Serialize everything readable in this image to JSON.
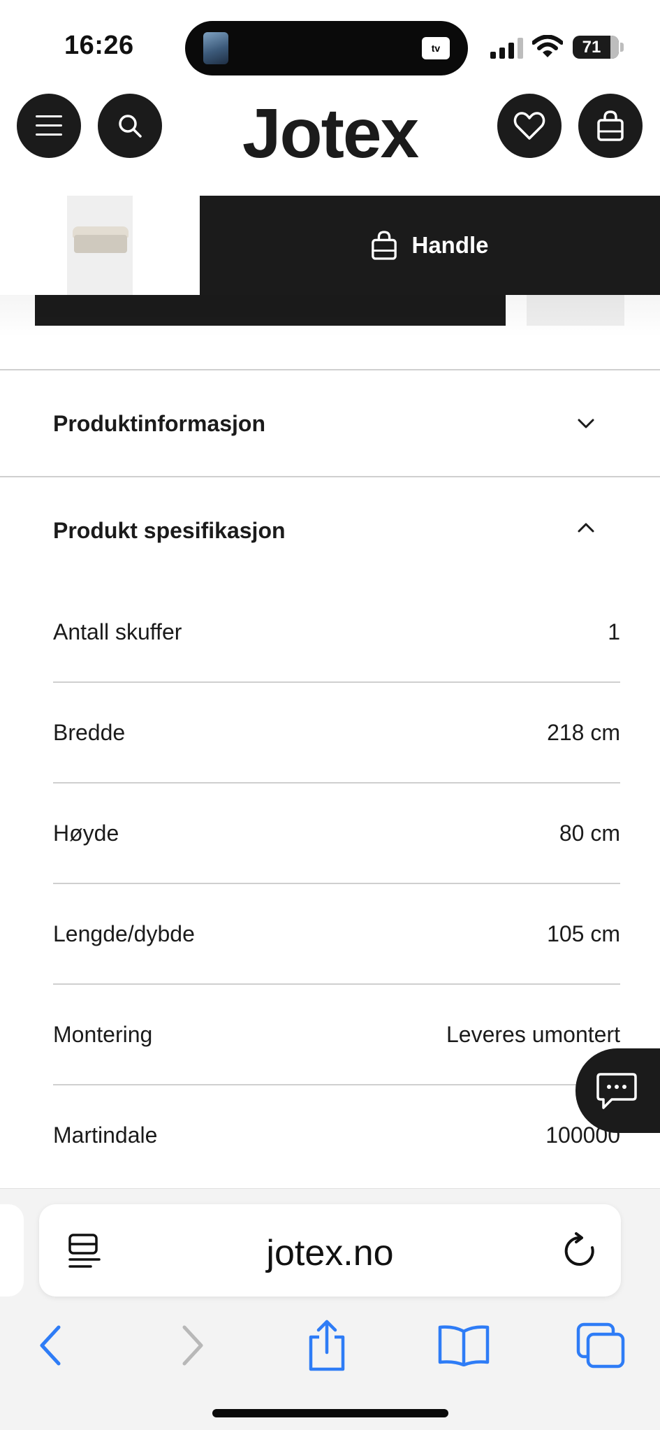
{
  "status_bar": {
    "time": "16:26",
    "tv_label": "tv",
    "battery_level": "71"
  },
  "header": {
    "logo": "Jotex",
    "menu_icon": "hamburger-menu-icon",
    "search_icon": "search-icon",
    "wishlist_icon": "heart-icon",
    "cart_icon": "shopping-bag-icon"
  },
  "sticky_bar": {
    "buy_label": "Handle",
    "buy_icon": "shopping-bag-icon"
  },
  "accordions": {
    "product_info": {
      "title": "Produktinformasjon",
      "state": "collapsed"
    },
    "product_spec": {
      "title": "Produkt spesifikasjon",
      "state": "expanded"
    }
  },
  "specs": [
    {
      "label": "Antall skuffer",
      "value": "1"
    },
    {
      "label": "Bredde",
      "value": "218 cm"
    },
    {
      "label": "Høyde",
      "value": "80 cm"
    },
    {
      "label": "Lengde/dybde",
      "value": "105 cm"
    },
    {
      "label": "Montering",
      "value": "Leveres umontert"
    },
    {
      "label": "Martindale",
      "value": "100000"
    }
  ],
  "chat": {
    "icon": "chat-bubble-icon"
  },
  "browser": {
    "url": "jotex.no",
    "reader_icon": "reader-mode-icon",
    "reload_icon": "reload-icon",
    "nav_icons": [
      "back-icon",
      "forward-icon",
      "share-icon",
      "bookmarks-icon",
      "tabs-icon"
    ],
    "accent_color": "#2e7cf6",
    "disabled_color": "#b8b8b8"
  }
}
